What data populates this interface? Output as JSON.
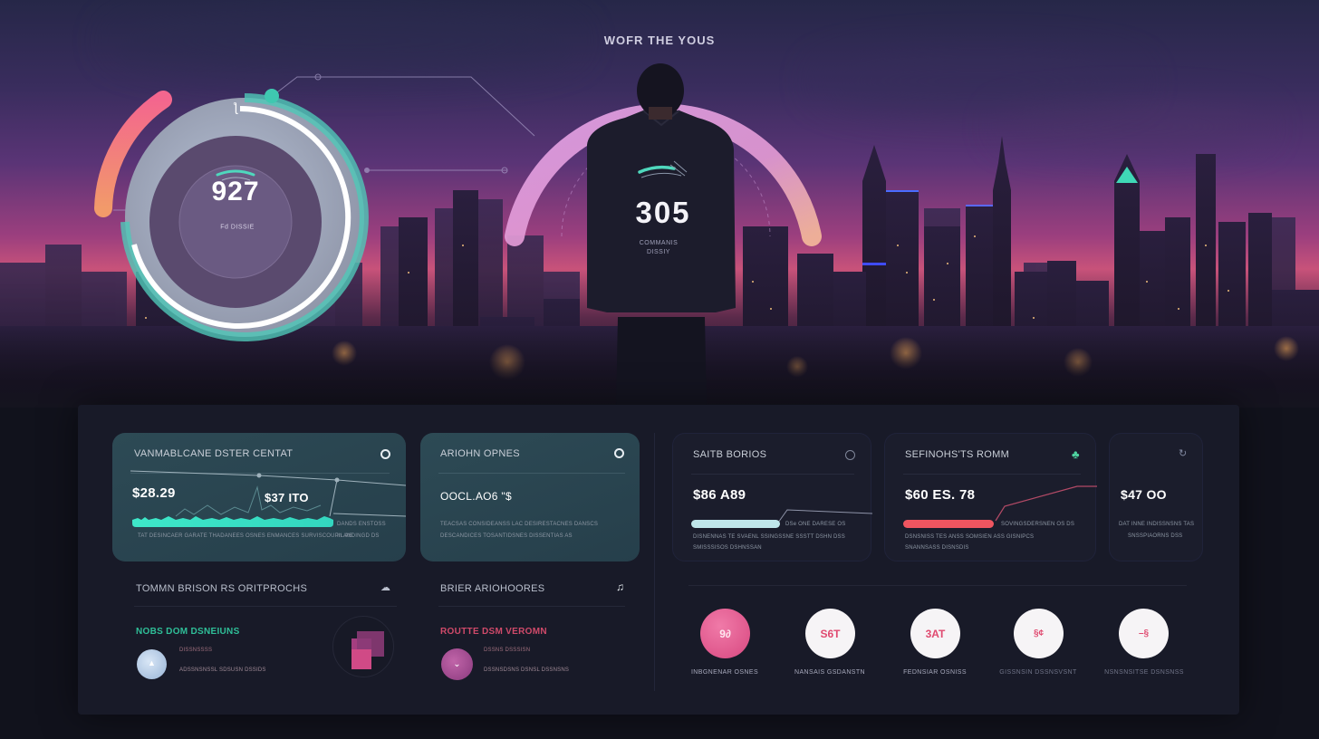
{
  "hero": {
    "title": "WOFR THE YOUS",
    "left_gauge": {
      "value": "927",
      "label": "Fd DISSIE",
      "progress_fraction": 0.82,
      "accent_color": "#4fc8b8",
      "arc_color_start": "#f06a8a",
      "arc_color_end": "#f3956a"
    },
    "center_gauge": {
      "value": "305",
      "label_line1": "COMMANIS",
      "label_line2": "DISSIY",
      "arc_color_start": "#e7a2e2",
      "arc_color_end": "#f2b39a"
    }
  },
  "cards_top": [
    {
      "title": "VANMABLCANE DSTER CENTAT",
      "value": "$28.29",
      "secondary_value": "$37 ITO",
      "bar_color": "#3ee8c9",
      "bar_fraction": 0.71,
      "footer_line1": "TAT  DESINCAER GARATE  THADANEES  OSNES  ENMANCES  SURVISCOUPIL AS",
      "side_line1": "DANDS ENSTOSS",
      "side_line2": "In ANDINGD DS",
      "icon": "settings-icon"
    },
    {
      "title": "ARIOHN OPNES",
      "value": "OOCL.AO6 \"$",
      "footer_line1": "TEACSAS  CONSIDEANSS LAC  DESIRESTACNES  DANSCS",
      "footer_line2": "DESCANDICES  TOSANTIDSNES  DISSENTIAS AS",
      "icon": "circle-icon"
    },
    {
      "title": "SAITB BORIOS",
      "value": "$86 A89",
      "bar_color": "#bfe6ea",
      "bar_fraction": 0.56,
      "side_line1": "DSe ONE DARESE OS",
      "footer_line1": "DISNENNAS TE SVAENL SSINGSSNE  SSSTT DSHN  DSS",
      "footer_line2": "SMISSSISOS  DSHNSSAN",
      "icon": "clock-icon"
    },
    {
      "title": "SEFINOHS'TS ROMM",
      "value": "$60 ES. 78",
      "bar_color": "#ef5560",
      "bar_fraction": 0.64,
      "side_line1": "SOVINGSDERSNEN OS DS",
      "footer_line1": "DSNSNISS TES ANSS SOMSIEN ASS GISNIPCS",
      "footer_line2": "SNANNSASS DISNSDIS",
      "icon": "leaf-icon",
      "icon_color": "#4fd3a0"
    },
    {
      "title": "",
      "value": "$47 OO",
      "footer_line1": "DAT INNE INDISSNSNS TAS",
      "footer_line2": "SNSSPIAORNS DSS",
      "icon": "refresh-icon"
    }
  ],
  "cards_bottom": [
    {
      "title": "TOMMN BRISON RS ORITPROCHS",
      "subtitle": "NOBS DOM DSNEIUNS",
      "subtitle_color": "#2fbf98",
      "line1": "DISSNSSSS",
      "line2": "ADSSNSNSSL SDSUSN DSSIDS",
      "icon": "cloud-icon"
    },
    {
      "title": "BRIER ARIOHOORES",
      "subtitle": "ROUTTE DSM VEROMN",
      "subtitle_color": "#d04a6a",
      "line1": "DSSNS DSSSISN",
      "line2": "DSSNSDSNS DSNSL DSSNSNS",
      "icon": "bell-icon"
    }
  ],
  "round_actions": [
    {
      "label": "INBGNENAR OSNES",
      "glyph": "9∂",
      "style": "pink"
    },
    {
      "label": "NANSAIS GSDANSTN",
      "glyph": "S6T",
      "style": "white"
    },
    {
      "label": "FEDNSIAR OSNISS",
      "glyph": "3AT",
      "style": "white"
    },
    {
      "label": "GISSNSIN DSSNSVSNT",
      "glyph": "§¢",
      "style": "white"
    },
    {
      "label": "NSNSNSITSE DSNSNSS",
      "glyph": "–§",
      "style": "white"
    }
  ],
  "colors": {
    "teal_accent": "#3ee8c9",
    "pink_accent": "#e8507e",
    "panel_bg": "#181a28"
  }
}
